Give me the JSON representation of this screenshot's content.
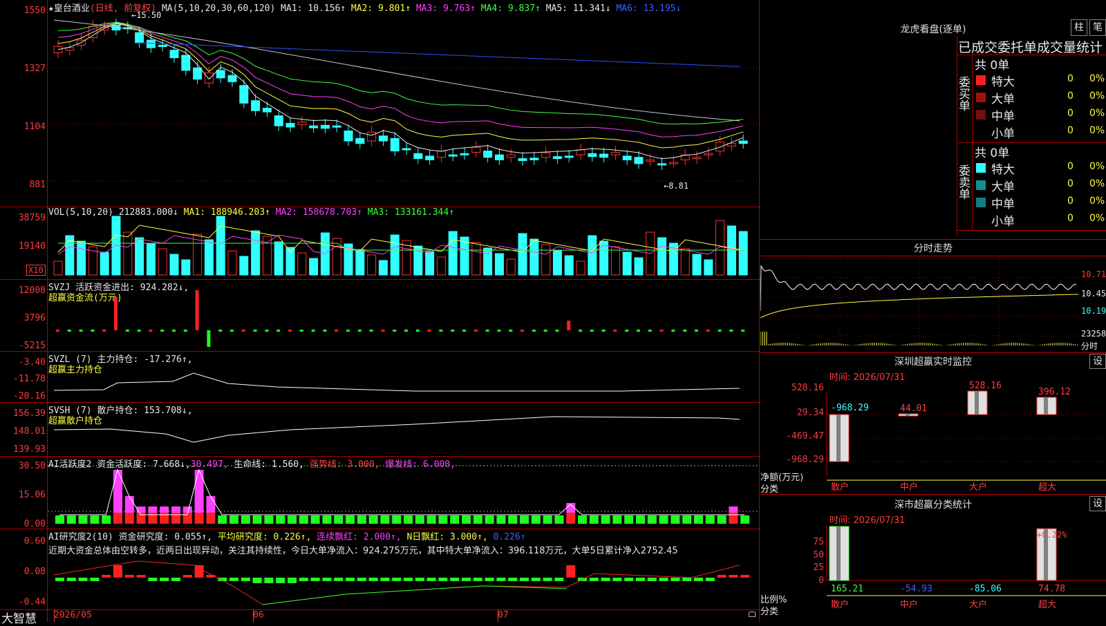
{
  "stock": {
    "name": "★皇台酒业",
    "period": "(日线, 前复权)",
    "ma_label": "MA(5,10,20,30,60,120)",
    "ma": [
      {
        "label": "MA1: 10.156↑",
        "color": "#e8e8e8"
      },
      {
        "label": "MA2: 9.801↑",
        "color": "#ffff40"
      },
      {
        "label": "MA3: 9.763↑",
        "color": "#ff40ff"
      },
      {
        "label": "MA4: 9.837↑",
        "color": "#40ff40"
      },
      {
        "label": "MA5: 11.341↓",
        "color": "#c8c8c8"
      },
      {
        "label": "MA6: 13.195↓",
        "color": "#4060ff"
      }
    ],
    "high_mark": "15.50",
    "low_mark": "8.81",
    "price_axis": [
      "1550",
      "1327",
      "1104",
      "881"
    ]
  },
  "vol": {
    "label": "VOL(5,10,20)",
    "values": [
      {
        "text": "212883.000↓",
        "color": "#e8e8e8"
      },
      {
        "text": "MA1: 188946.203↑",
        "color": "#ffff40"
      },
      {
        "text": "MA2: 158678.703↑",
        "color": "#ff40ff"
      },
      {
        "text": "MA3: 133161.344↑",
        "color": "#40ff40"
      }
    ],
    "axis": [
      "38759",
      "19140"
    ],
    "unit": "X10"
  },
  "svzj": {
    "label": "SVZJ  活跃资金进出: 924.282↓,",
    "sub": "超赢资金流(万元)",
    "axis": [
      "12008",
      "3796",
      "-5215"
    ]
  },
  "svzl": {
    "label": "SVZL (7) 主力持仓: -17.276↑,",
    "sub": "超赢主力持仓",
    "axis": [
      "-3.40",
      "-11.78",
      "-20.16"
    ]
  },
  "svsh": {
    "label": "SVSH (7) 散户持仓: 153.708↓,",
    "sub": "超赢散户持仓",
    "axis": [
      "156.39",
      "148.01",
      "139.93"
    ]
  },
  "ai1": {
    "label": "AI活跃度2 资金活跃度: 7.668↓,",
    "v2": "30.497,",
    "v3": "生命线: 1.560,",
    "v4": "强势线: 3.000,",
    "v5": "爆发线: 6.000,",
    "axis": [
      "30.50",
      "15.06",
      "0.00"
    ]
  },
  "ai2": {
    "label": "AI研究度2(10) 资金研究度: 0.055↑,",
    "v2": "平均研究度: 0.226↑,",
    "v3": "连续飘红: 2.000↑,",
    "v4": "N日飘红: 3.000↑,",
    "v5": "0.226↑",
    "comment": "近期大资金总体由空转多，近两日出现异动，关注其持续性，今日大单净流入：924.275万元，其中特大单净流入：396.118万元，大单5日累计净入2752.45",
    "axis": [
      "0.60",
      "0.08",
      "-0.44"
    ]
  },
  "bottom": {
    "brand": "大智慧",
    "dates": [
      "2026/05",
      "06",
      "07"
    ]
  },
  "right": {
    "title": "龙虎看盘(逐单)",
    "btn1": "柱",
    "btn2": "笔",
    "stats_title": "已成交委托单成交量统计",
    "buy": {
      "side": "委买单",
      "total": "共 0单",
      "rows": [
        {
          "label": "特大",
          "val": "0",
          "pct": "0%",
          "color": "#ff2020"
        },
        {
          "label": "大单",
          "val": "0",
          "pct": "0%",
          "color": "#a01010"
        },
        {
          "label": "中单",
          "val": "0",
          "pct": "0%",
          "color": "#701010"
        },
        {
          "label": "小单",
          "val": "0",
          "pct": "0%",
          "color": "#000000"
        }
      ]
    },
    "sell": {
      "side": "委卖单",
      "total": "共 0单",
      "rows": [
        {
          "label": "特大",
          "val": "0",
          "pct": "0%",
          "color": "#30ffff"
        },
        {
          "label": "大单",
          "val": "0",
          "pct": "0%",
          "color": "#109090"
        },
        {
          "label": "中单",
          "val": "0",
          "pct": "0%",
          "color": "#108080"
        },
        {
          "label": "小单",
          "val": "0",
          "pct": "0%",
          "color": "#000000"
        }
      ]
    },
    "intraday": {
      "title": "分时走势",
      "axis": [
        "10.71",
        "10.45",
        "10.19",
        "23258"
      ],
      "unit": "分时"
    },
    "sz_monitor": {
      "title": "深圳超赢实时监控",
      "btn": "设",
      "time": "时间: 2026/07/31",
      "axis": [
        "528.16",
        "29.34",
        "-469.47",
        "-968.29"
      ],
      "bars": [
        {
          "label": "散户",
          "value": "-968.29"
        },
        {
          "label": "中户",
          "value": "44.01"
        },
        {
          "label": "大户",
          "value": "528.16"
        },
        {
          "label": "超大",
          "value": "396.12"
        }
      ],
      "y_title": "净额(万元)",
      "x_title": "分类"
    },
    "sz_class": {
      "title": "深市超赢分类统计",
      "btn": "设",
      "time": "时间: 2026/07/31",
      "axis": [
        "75",
        "50",
        "25",
        "0"
      ],
      "bars": [
        {
          "label": "散户",
          "value": "165.21",
          "color": "#40ff40"
        },
        {
          "label": "中户",
          "value": "-54.93",
          "color": "#4060ff"
        },
        {
          "label": "大户",
          "value": "-85.06",
          "color": "#40ffff"
        },
        {
          "label": "超大",
          "value": "74.78",
          "color": "#ff4040"
        }
      ],
      "top_label": "+0.22%",
      "y_title": "比例%",
      "x_title": "分类"
    }
  }
}
